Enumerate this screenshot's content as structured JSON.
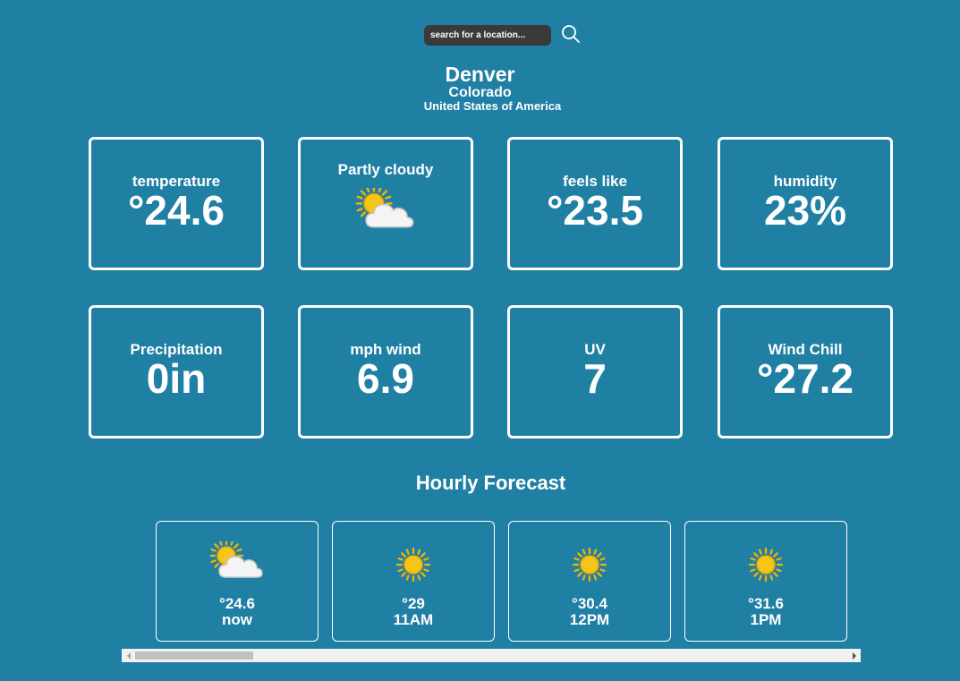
{
  "search": {
    "placeholder": "search for a location..."
  },
  "location": {
    "city": "Denver",
    "region": "Colorado",
    "country": "United States of America"
  },
  "cards": [
    {
      "label": "temperature",
      "value": "°24.6"
    },
    {
      "label": "Partly cloudy",
      "icon": "partly-cloudy-icon"
    },
    {
      "label": "feels like",
      "value": "°23.5"
    },
    {
      "label": "humidity",
      "value": "23%"
    },
    {
      "label": "Precipitation",
      "value": "0in"
    },
    {
      "label": "mph wind",
      "value": "6.9"
    },
    {
      "label": "UV",
      "value": "7"
    },
    {
      "label": "Wind Chill",
      "value": "°27.2"
    }
  ],
  "forecast": {
    "title": "Hourly Forecast",
    "hours": [
      {
        "temp": "°24.6",
        "time": "now",
        "icon": "partly-cloudy-icon"
      },
      {
        "temp": "°29",
        "time": "11AM",
        "icon": "sun-icon"
      },
      {
        "temp": "°30.4",
        "time": "12PM",
        "icon": "sun-icon"
      },
      {
        "temp": "°31.6",
        "time": "1PM",
        "icon": "sun-icon"
      }
    ],
    "scroll_position": 0
  },
  "colors": {
    "background": "#2080a4",
    "search_bg": "#3a3a3a",
    "sun": "#f5c518",
    "border": "#ffffff"
  }
}
